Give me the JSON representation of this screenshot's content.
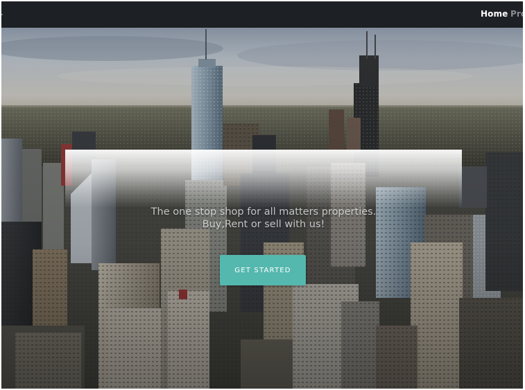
{
  "navbar": {
    "links": [
      {
        "label": "Home"
      },
      {
        "label": "Pro"
      }
    ]
  },
  "hero": {
    "tagline_line1": "The one stop shop for all matters properties.",
    "tagline_line2": "Buy,Rent or sell with us!",
    "cta_label": "GET STARTED",
    "cta_color": "#55b8ae",
    "background_image": "city-skyline-photo"
  }
}
